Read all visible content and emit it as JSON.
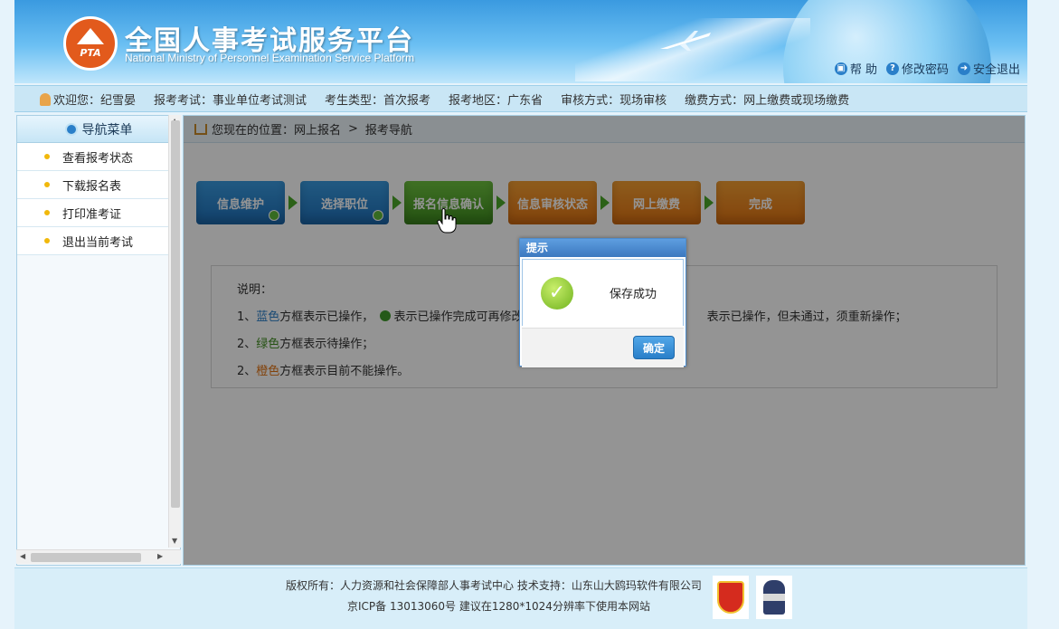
{
  "header": {
    "logo_text": "PTA",
    "title": "全国人事考试服务平台",
    "subtitle": "National Ministry of Personnel Examination Service Platform",
    "links": [
      {
        "icon": "lock-icon",
        "label": "帮 助"
      },
      {
        "icon": "question-icon",
        "label": "修改密码"
      },
      {
        "icon": "logout-icon",
        "label": "安全退出"
      }
    ]
  },
  "info_bar": {
    "welcome": "欢迎您：纪雪晏",
    "exam": "报考考试：事业单位考试测试",
    "candidate_type": "考生类型：首次报考",
    "region": "报考地区：广东省",
    "review": "审核方式：现场审核",
    "payment": "缴费方式：网上缴费或现场缴费"
  },
  "sidebar": {
    "title": "导航菜单",
    "items": [
      {
        "label": "查看报考状态"
      },
      {
        "label": "下载报名表"
      },
      {
        "label": "打印准考证"
      },
      {
        "label": "退出当前考试"
      }
    ]
  },
  "breadcrumb": {
    "prefix": "您现在的位置：网上报名",
    "separator": ">",
    "current": "报考导航"
  },
  "steps": [
    {
      "label": "信息维护",
      "status": "blue",
      "done": true
    },
    {
      "label": "选择职位",
      "status": "blue",
      "done": true
    },
    {
      "label": "报名信息确认",
      "status": "green",
      "done": false
    },
    {
      "label": "信息审核状态",
      "status": "orange",
      "done": false
    },
    {
      "label": "网上缴费",
      "status": "orange",
      "done": false
    },
    {
      "label": "完成",
      "status": "orange",
      "done": false
    }
  ],
  "explain": {
    "title": "说明：",
    "l1_prefix": "1、",
    "l1_color": "蓝色",
    "l1_text": "方框表示已操作，",
    "l1_check_text": "表示已操作完成可再修改，",
    "l1_tail": "表示已操作，但未通过，须重新操作；",
    "l2_prefix": "2、",
    "l2_color": "绿色",
    "l2_text": "方框表示待操作；",
    "l3_prefix": "2、",
    "l3_color": "橙色",
    "l3_text": "方框表示目前不能操作。"
  },
  "dialog": {
    "title": "提示",
    "message": "保存成功",
    "ok_label": "确定"
  },
  "footer": {
    "line1": "版权所有：人力资源和社会保障部人事考试中心  技术支持：山东山大鸥玛软件有限公司",
    "line2": "京ICP备 13013060号  建议在1280*1024分辨率下使用本网站"
  },
  "colors": {
    "step_blue": "#1e6fb8",
    "step_green": "#3e8c1e",
    "step_orange": "#e07212",
    "dialog_header": "#3b78bf"
  }
}
